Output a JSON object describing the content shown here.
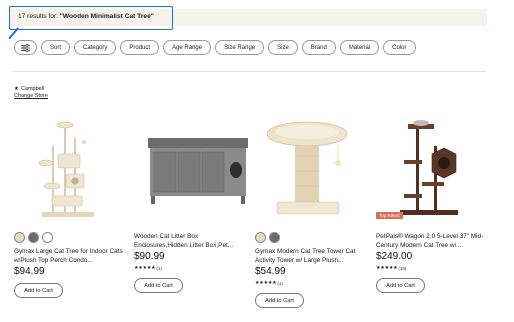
{
  "search": {
    "count": "17",
    "prefix": " results for: ",
    "query": "\"Wooden Minimalist Cat Tree\""
  },
  "filters": [
    "Sort",
    "Category",
    "Product",
    "Age Range",
    "Size Range",
    "Size",
    "Brand",
    "Material",
    "Color"
  ],
  "store": {
    "name": "Campbell",
    "change_label": "Change Store"
  },
  "products": [
    {
      "title": "Gymax Large Cat Tree for Indoor Cats w/Plush Top Perch Condo...",
      "price": "$94.99",
      "button": "Add to Cart",
      "swatches": [
        "#e8dcc5",
        "#6b6b6b",
        "#ffffff"
      ]
    },
    {
      "title": "Wooden Cat Litter Box Enclosures,Hidden Litter Box,Pet...",
      "price": "$90.99",
      "rating_count": "(1)",
      "button": "Add to Cart"
    },
    {
      "title": "Gymax Modern Cat Tree Tower Cat Activity Tower w/ Large Plush...",
      "price": "$54.99",
      "rating_count": "(1)",
      "button": "Add to Cart",
      "swatches": [
        "#e8dcc5",
        "#6b6b6b"
      ]
    },
    {
      "badge": "Top Rated",
      "title": "PetPals® Wagon 2.0 5-Level 37\" Mid-Century Modern Cat Tree wi...",
      "price": "$249.00",
      "rating_count": "(18)",
      "button": "Add to Cart"
    }
  ],
  "colors": {
    "highlight": "#1f6fd6",
    "results_bg": "#f6f3ec",
    "badge": "#d9715a"
  }
}
